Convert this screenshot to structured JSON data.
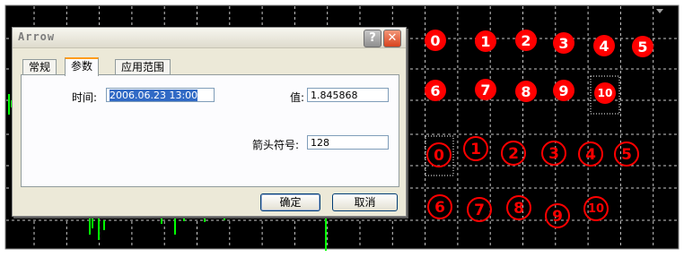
{
  "chart": {
    "background": "#000000",
    "grid_color": "#c8c8c8",
    "circle_color": "#ff0000",
    "marker_color": "#ffffff"
  },
  "filled_markers": [
    "0",
    "1",
    "2",
    "3",
    "4",
    "5",
    "6",
    "7",
    "8",
    "9",
    "10"
  ],
  "outlined_markers": [
    "0",
    "1",
    "2",
    "3",
    "4",
    "5",
    "6",
    "7",
    "8",
    "9",
    "10"
  ],
  "dialog": {
    "title": "Arrow",
    "help_icon": "?",
    "close_icon": "✕",
    "tabs": [
      "常规",
      "参数",
      "应用范围"
    ],
    "active_tab": "参数",
    "time_label": "时间:",
    "time_value": "2006.06.23 13:00",
    "value_label": "值:",
    "value_value": "1.845868",
    "arrow_code_label": "箭头符号:",
    "arrow_code_value": "128",
    "ok_label": "确定",
    "cancel_label": "取消"
  }
}
